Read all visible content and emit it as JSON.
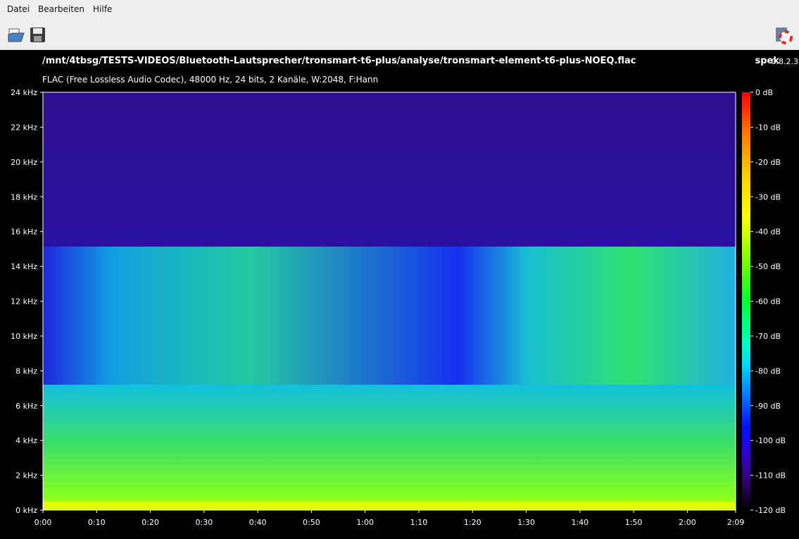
{
  "menu": [
    "Datei",
    "Bearbeiten",
    "Hilfe"
  ],
  "toolbar": {
    "open_icon": "open-folder-icon",
    "save_icon": "save-disk-icon",
    "help_icon": "lifebuoy-icon"
  },
  "header": {
    "path": "/mnt/4tbsg/TESTS-VIDEOS/Bluetooth-Lautsprecher/tronsmart-t6-plus/analyse/tronsmart-element-t6-plus-NOEQ.flac",
    "info": "FLAC (Free Lossless Audio Codec), 48000 Hz, 24 bits, 2 Kanäle, W:2048, F:Hann",
    "app_name": "spek",
    "app_version": "0.8.2.3"
  },
  "y_axis": [
    "24 kHz",
    "22 kHz",
    "20 kHz",
    "18 kHz",
    "16 kHz",
    "14 kHz",
    "12 kHz",
    "10 kHz",
    "8 kHz",
    "6 kHz",
    "4 kHz",
    "2 kHz",
    "0 kHz"
  ],
  "x_axis": [
    "0:00",
    "0:10",
    "0:20",
    "0:30",
    "0:40",
    "0:50",
    "1:00",
    "1:10",
    "1:20",
    "1:30",
    "1:40",
    "1:50",
    "2:00",
    "2:09"
  ],
  "legend": [
    "0 dB",
    "-10 dB",
    "-20 dB",
    "-30 dB",
    "-40 dB",
    "-50 dB",
    "-60 dB",
    "-70 dB",
    "-80 dB",
    "-90 dB",
    "-100 dB",
    "-110 dB",
    "-120 dB"
  ],
  "colors": {
    "background": "#000000",
    "toolbar_bg": "#efefef",
    "spectrum_floor": "#2b0f8a"
  }
}
